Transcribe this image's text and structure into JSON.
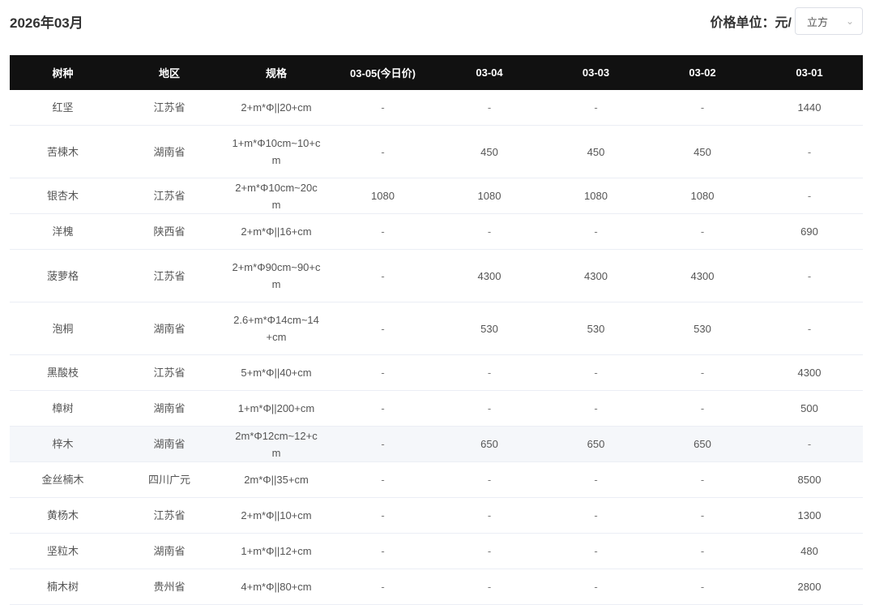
{
  "header": {
    "month": "2026年03月",
    "unit_label": "价格单位：元/",
    "unit_value": "立方"
  },
  "table": {
    "columns": [
      "树种",
      "地区",
      "规格",
      "03-05(今日价)",
      "03-04",
      "03-03",
      "03-02",
      "03-01"
    ],
    "rows": [
      {
        "species": "红坚",
        "region": "江苏省",
        "spec": "2+m*Φ||20+cm",
        "p0305": "-",
        "p0304": "-",
        "p0303": "-",
        "p0302": "-",
        "p0301": "1440"
      },
      {
        "species": "苦楝木",
        "region": "湖南省",
        "spec": "1+m*Φ10cm~10+cm",
        "p0305": "-",
        "p0304": "450",
        "p0303": "450",
        "p0302": "450",
        "p0301": "-"
      },
      {
        "species": "银杏木",
        "region": "江苏省",
        "spec": "2+m*Φ10cm~20cm",
        "p0305": "1080",
        "p0304": "1080",
        "p0303": "1080",
        "p0302": "1080",
        "p0301": "-"
      },
      {
        "species": "洋槐",
        "region": "陕西省",
        "spec": "2+m*Φ||16+cm",
        "p0305": "-",
        "p0304": "-",
        "p0303": "-",
        "p0302": "-",
        "p0301": "690"
      },
      {
        "species": "菠萝格",
        "region": "江苏省",
        "spec": "2+m*Φ90cm~90+cm",
        "p0305": "-",
        "p0304": "4300",
        "p0303": "4300",
        "p0302": "4300",
        "p0301": "-"
      },
      {
        "species": "泡桐",
        "region": "湖南省",
        "spec": "2.6+m*Φ14cm~14+cm",
        "p0305": "-",
        "p0304": "530",
        "p0303": "530",
        "p0302": "530",
        "p0301": "-"
      },
      {
        "species": "黑酸枝",
        "region": "江苏省",
        "spec": "5+m*Φ||40+cm",
        "p0305": "-",
        "p0304": "-",
        "p0303": "-",
        "p0302": "-",
        "p0301": "4300"
      },
      {
        "species": "樟树",
        "region": "湖南省",
        "spec": "1+m*Φ||200+cm",
        "p0305": "-",
        "p0304": "-",
        "p0303": "-",
        "p0302": "-",
        "p0301": "500"
      },
      {
        "species": "梓木",
        "region": "湖南省",
        "spec": "2m*Φ12cm~12+cm",
        "p0305": "-",
        "p0304": "650",
        "p0303": "650",
        "p0302": "650",
        "p0301": "-"
      },
      {
        "species": "金丝楠木",
        "region": "四川广元",
        "spec": "2m*Φ||35+cm",
        "p0305": "-",
        "p0304": "-",
        "p0303": "-",
        "p0302": "-",
        "p0301": "8500"
      },
      {
        "species": "黄杨木",
        "region": "江苏省",
        "spec": "2+m*Φ||10+cm",
        "p0305": "-",
        "p0304": "-",
        "p0303": "-",
        "p0302": "-",
        "p0301": "1300"
      },
      {
        "species": "坚粒木",
        "region": "湖南省",
        "spec": "1+m*Φ||12+cm",
        "p0305": "-",
        "p0304": "-",
        "p0303": "-",
        "p0302": "-",
        "p0301": "480"
      },
      {
        "species": "楠木树",
        "region": "贵州省",
        "spec": "4+m*Φ||80+cm",
        "p0305": "-",
        "p0304": "-",
        "p0303": "-",
        "p0302": "-",
        "p0301": "2800"
      }
    ]
  }
}
